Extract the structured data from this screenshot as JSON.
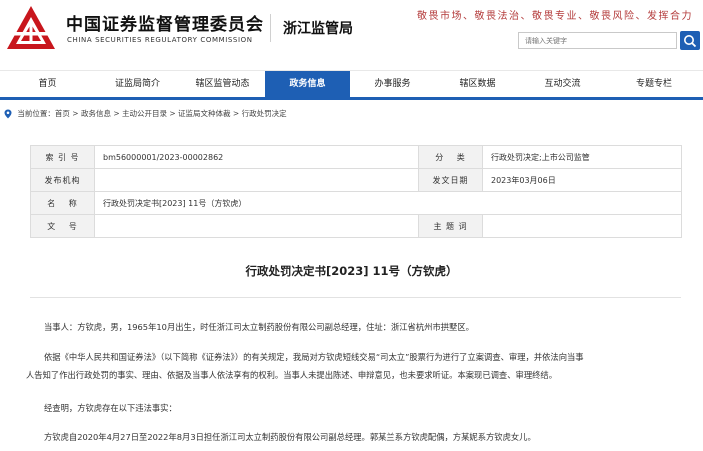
{
  "header": {
    "org_cn": "中国证券监督管理委员会",
    "org_en": "CHINA SECURITIES REGULATORY COMMISSION",
    "bureau": "浙江监管局",
    "slogan": "敬畏市场、敬畏法治、敬畏专业、敬畏风险、发挥合力",
    "search_placeholder": "请输入关键字",
    "brand_color": "#c8161d",
    "accent_color": "#1e5fb4"
  },
  "nav": {
    "items": [
      {
        "label": "首页"
      },
      {
        "label": "证监局简介"
      },
      {
        "label": "辖区监管动态"
      },
      {
        "label": "政务信息",
        "active": true
      },
      {
        "label": "办事服务"
      },
      {
        "label": "辖区数据"
      },
      {
        "label": "互动交流"
      },
      {
        "label": "专题专栏"
      }
    ]
  },
  "breadcrumb": {
    "prefix": "当前位置：",
    "path": "首页 > 政务信息 > 主动公开目录 > 证监局文种体裁 > 行政处罚决定"
  },
  "info": {
    "index_label": "索 引 号",
    "index_value": "bm56000001/2023-00002862",
    "category_label": "分　 类",
    "category_value": "行政处罚决定;上市公司监管",
    "issuer_label": "发布机构",
    "issuer_value": "",
    "date_label": "发文日期",
    "date_value": "2023年03月06日",
    "name_label": "名　 称",
    "name_value": "行政处罚决定书[2023] 11号（方钦虎）",
    "docno_label": "文　 号",
    "docno_value": "",
    "keywords_label": "主 题 词",
    "keywords_value": ""
  },
  "document": {
    "title": "行政处罚决定书[2023] 11号（方钦虎）",
    "p1": "当事人：方钦虎，男，1965年10月出生，时任浙江司太立制药股份有限公司副总经理，住址：浙江省杭州市拱墅区。",
    "p2_line1": "依据《中华人民共和国证券法》（以下简称《证券法》）的有关规定，我局对方钦虎短线交易“司太立”股票行为进行了立案调查、审理，并依法向当事",
    "p2_line2": "人告知了作出行政处罚的事实、理由、依据及当事人依法享有的权利。当事人未提出陈述、申辩意见，也未要求听证。本案现已调查、审理终结。",
    "p3": "经查明，方钦虎存在以下违法事实：",
    "p4": "方钦虎自2020年4月27日至2022年8月3日担任浙江司太立制药股份有限公司副总经理。郭某兰系方钦虎配偶，方某妮系方钦虎女儿。"
  }
}
